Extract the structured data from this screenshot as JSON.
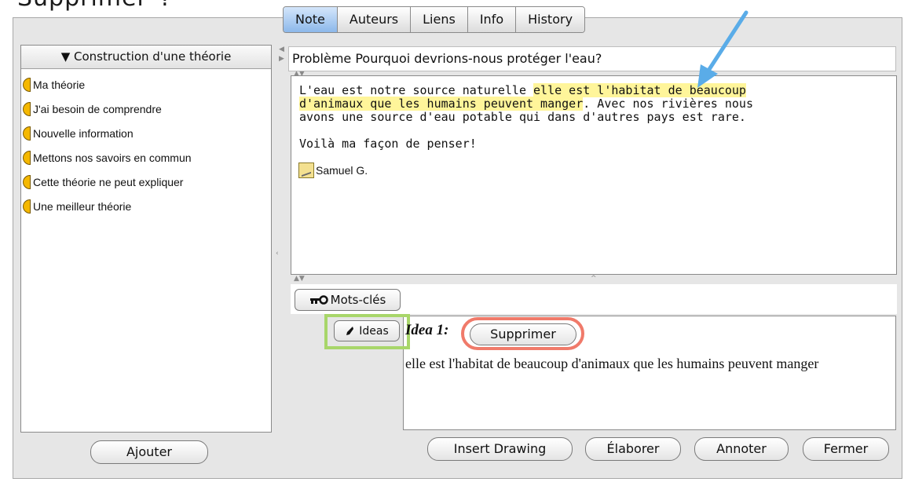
{
  "caption_cut": "Supprimer\"?",
  "tabs": [
    "Note",
    "Auteurs",
    "Liens",
    "Info",
    "History"
  ],
  "active_tab": "Note",
  "left_panel": {
    "header": "▼ Construction d'une théorie",
    "items": [
      "Ma théorie",
      "J'ai besoin de comprendre",
      "Nouvelle information",
      "Mettons nos savoirs en commun",
      "Cette théorie ne peut expliquer",
      "Une meilleur théorie"
    ],
    "add_button": "Ajouter"
  },
  "problem_title": "Problème Pourquoi devrions-nous protéger l'eau?",
  "note": {
    "text_part1": "L'eau est notre source naturelle ",
    "highlight1": "elle est l'habitat de beaucoup",
    "newline": "\n",
    "highlight2": "d'animaux que les humains peuvent manger",
    "text_part2": ". Avec nos rivières nous\navons une source d'eau potable qui dans d'autres pays est rare.\n\nVoilà ma façon de penser!",
    "author": "Samuel G."
  },
  "keywords_button": "Mots-clés",
  "ideas_button": "Ideas",
  "idea": {
    "label": "Idea 1:",
    "delete_button": "Supprimer",
    "text": "elle est l'habitat de beaucoup d'animaux que les humains peuvent manger"
  },
  "bottom_buttons": {
    "insert_drawing": "Insert Drawing",
    "elaborer": "Élaborer",
    "annoter": "Annoter",
    "fermer": "Fermer"
  },
  "colors": {
    "highlight": "#fff59a",
    "active_tab": "#8cb8ea",
    "scaffold_moon": "#f5b800",
    "annotation_circle": "#f07a6a",
    "annotation_box": "#a8d66a",
    "annotation_arrow": "#5aace8"
  }
}
